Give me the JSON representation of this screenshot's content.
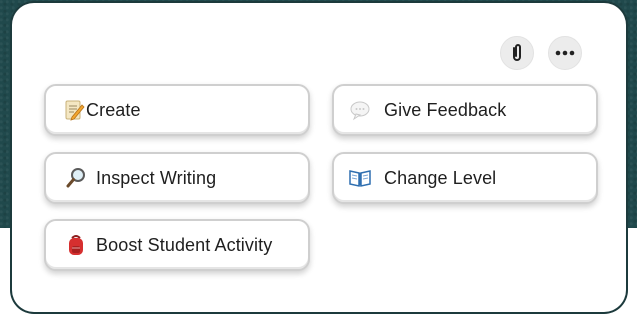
{
  "toolbar": {
    "attach_icon": "paperclip-icon",
    "more_icon": "more-horizontal-icon"
  },
  "actions": [
    {
      "label": "Create",
      "icon": "memo-icon"
    },
    {
      "label": "Give Feedback",
      "icon": "speech-bubble-icon"
    },
    {
      "label": "Inspect Writing",
      "icon": "magnifying-glass-icon"
    },
    {
      "label": "Change Level",
      "icon": "open-book-icon"
    },
    {
      "label": "Boost Student Activity",
      "icon": "backpack-icon"
    }
  ],
  "colors": {
    "background": "#20494c",
    "panel": "#ffffff",
    "chip_border": "#cfcfcf",
    "text": "#1f1f1f"
  }
}
